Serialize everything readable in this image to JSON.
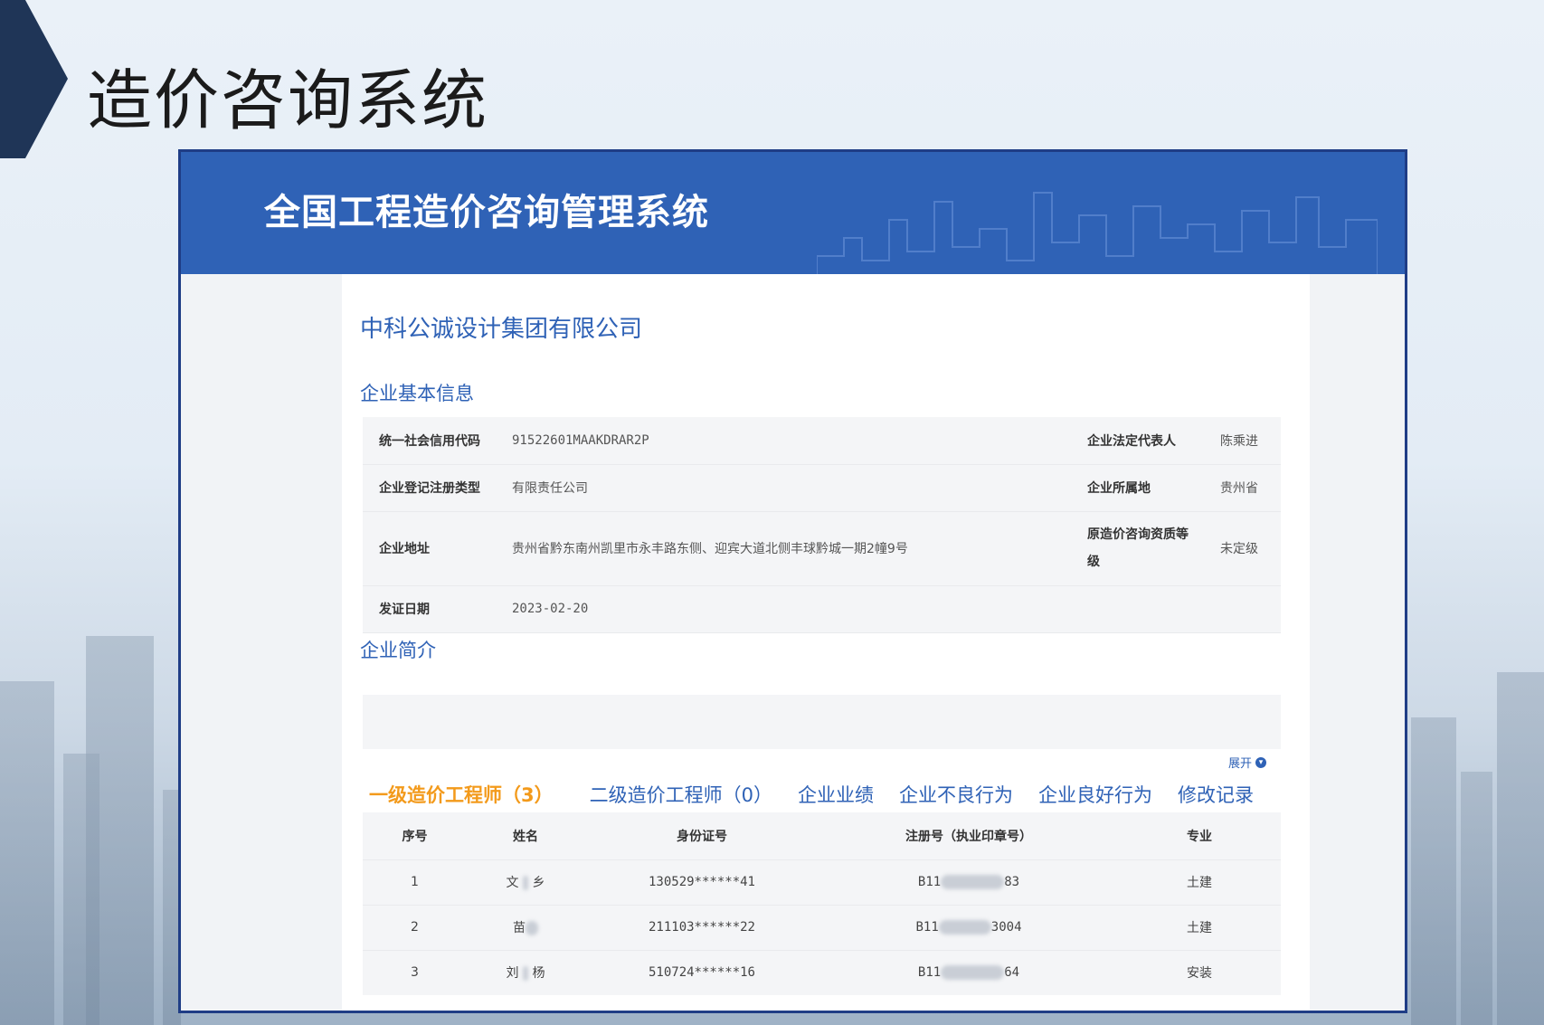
{
  "slide": {
    "title": "造价咨询系统"
  },
  "system": {
    "title": "全国工程造价咨询管理系统"
  },
  "company": {
    "name": "中科公诚设计集团有限公司"
  },
  "sections": {
    "basic_info": "企业基本信息",
    "intro": "企业简介"
  },
  "basic_info": {
    "credit_code_label": "统一社会信用代码",
    "credit_code": "91522601MAAKDRAR2P",
    "legal_rep_label": "企业法定代表人",
    "legal_rep": "陈乘进",
    "reg_type_label": "企业登记注册类型",
    "reg_type": "有限责任公司",
    "location_label": "企业所属地",
    "location": "贵州省",
    "address_label": "企业地址",
    "address": "贵州省黔东南州凯里市永丰路东侧、迎宾大道北侧丰球黔城一期2幢9号",
    "qual_label_1": "原造价咨询资质等",
    "qual_label_2": "级",
    "qual": "未定级",
    "issue_date_label": "发证日期",
    "issue_date": "2023-02-20"
  },
  "expand_label": "展开",
  "tabs": [
    {
      "label": "一级造价工程师（3）"
    },
    {
      "label": "二级造价工程师（0）"
    },
    {
      "label": "企业业绩"
    },
    {
      "label": "企业不良行为"
    },
    {
      "label": "企业良好行为"
    },
    {
      "label": "修改记录"
    }
  ],
  "staff_table": {
    "headers": [
      "序号",
      "姓名",
      "身份证号",
      "注册号（执业印章号）",
      "专业"
    ],
    "rows": [
      {
        "no": "1",
        "name_a": "文",
        "name_b": "乡",
        "id": "130529******41",
        "reg_prefix": "B11",
        "reg_suffix": "83",
        "major": "土建"
      },
      {
        "no": "2",
        "name_a": "苗",
        "name_b": "",
        "id": "211103******22",
        "reg_prefix": "B11",
        "reg_suffix": "3004",
        "major": "土建"
      },
      {
        "no": "3",
        "name_a": "刘",
        "name_b": "杨",
        "id": "510724******16",
        "reg_prefix": "B11",
        "reg_suffix": "64",
        "major": "安装"
      }
    ]
  },
  "colors": {
    "brand_blue": "#2f62b6",
    "frame_navy": "#1f3d86",
    "active_tab": "#f39a1b"
  }
}
